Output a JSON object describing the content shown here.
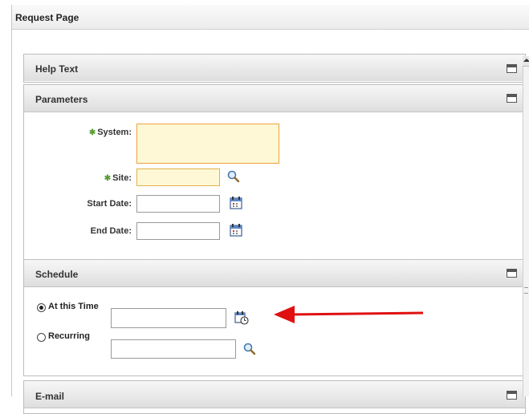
{
  "window": {
    "title": "Request Page"
  },
  "panels": {
    "help": {
      "title": "Help Text"
    },
    "parameters": {
      "title": "Parameters",
      "fields": {
        "system": {
          "label": "System:",
          "value": ""
        },
        "site": {
          "label": "Site:",
          "value": ""
        },
        "start_date": {
          "label": "Start Date:",
          "value": ""
        },
        "end_date": {
          "label": "End Date:",
          "value": ""
        }
      }
    },
    "schedule": {
      "title": "Schedule",
      "options": [
        {
          "label": "At this Time",
          "selected": true,
          "value": ""
        },
        {
          "label": "Recurring",
          "selected": false,
          "value": ""
        }
      ]
    },
    "email": {
      "title": "E-mail"
    }
  },
  "annotation": {
    "color": "#e01010"
  },
  "icons": {
    "search": "magnifier-icon",
    "calendar": "calendar-icon",
    "schedule_calendar": "calendar-clock-icon",
    "collapse": "collapse-icon"
  },
  "colors": {
    "required_fill": "#fff8d6",
    "required_border": "#f0a040",
    "required_star": "#5c9c3c"
  }
}
